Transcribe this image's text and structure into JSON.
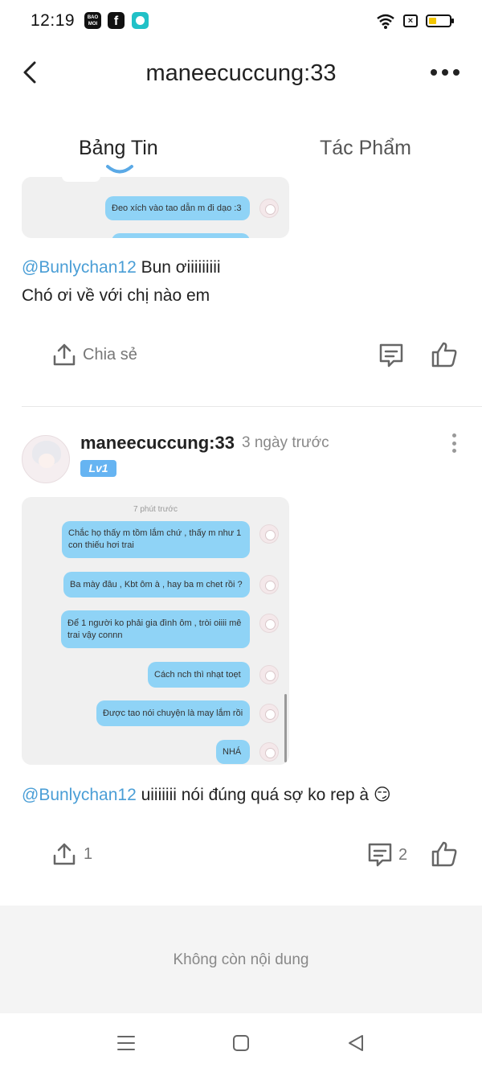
{
  "status_bar": {
    "time": "12:19",
    "apps": [
      "BAO MOI",
      "f",
      "chat-bubble-icon"
    ],
    "icons": [
      "wifi-icon",
      "sim-x-icon",
      "battery-icon"
    ],
    "sim_label": "×",
    "baomoi_label": "BAO MOI",
    "fb_label": "f",
    "battery_level": 0.25
  },
  "header": {
    "title": "maneecuccung:33"
  },
  "tabs": [
    {
      "label": "Bảng Tin",
      "active": true
    },
    {
      "label": "Tác Phẩm",
      "active": false
    }
  ],
  "post1": {
    "image_bubbles": [
      {
        "text": "Đeo xích vào tao dẫn m đi dạo :3"
      }
    ],
    "mention": "@Bunlychan12",
    "text_line1": " Bun ơiiiiiiiii",
    "text_line2": "Chó ơi về với chị nào em",
    "share_label": "Chia sẻ"
  },
  "post2": {
    "username": "maneecuccung:33",
    "time": "3 ngày trước",
    "level": "Lv1",
    "image": {
      "timestamp": "7 phút trước",
      "bubbles": [
        "Chắc họ thấy m tồm lắm chứ , thấy m như 1 con thiếu hơi trai",
        "Ba mày đâu , Kbt ôm à , hay ba m chet rồi ?",
        "Để 1 người ko phải gia đình ôm , tròi oiiii mê trai vậy connn",
        "Cách nch thì nhạt toẹt",
        "Được tao nói chuyện là may lắm rồi",
        "NHÁ"
      ]
    },
    "mention": "@Bunlychan12",
    "text": " uiiiiiii nói đúng quá sợ ko rep à 😏",
    "share_count": "1",
    "comment_count": "2"
  },
  "footer": {
    "end_text": "Không còn nội dung"
  },
  "colors": {
    "mention": "#4a9ed6",
    "bubble": "#8fd3f6",
    "level_badge": "#66b4f2",
    "tab_indicator": "#5aa9e6"
  }
}
